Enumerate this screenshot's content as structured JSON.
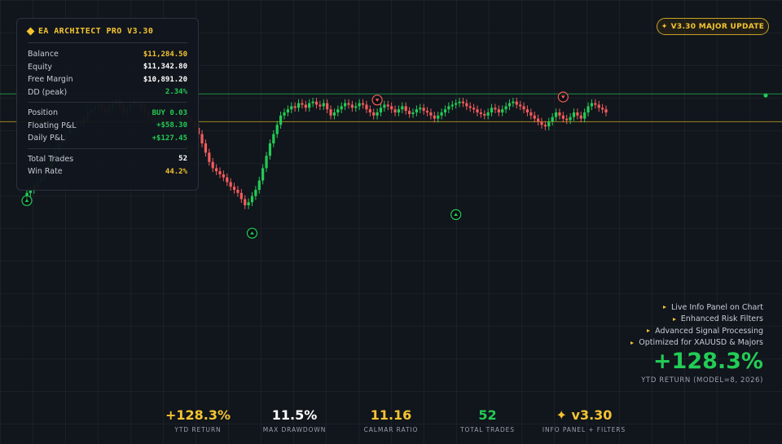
{
  "info_panel": {
    "title": "EA ARCHITECT PRO V3.30",
    "groups": [
      [
        {
          "label": "Balance",
          "value": "$11,284.50",
          "color": "#f4c430"
        },
        {
          "label": "Equity",
          "value": "$11,342.80",
          "color": "#ffffff"
        },
        {
          "label": "Free Margin",
          "value": "$10,891.20",
          "color": "#ffffff"
        },
        {
          "label": "DD (peak)",
          "value": "2.34%",
          "color": "#22cc55"
        }
      ],
      [
        {
          "label": "Position",
          "value": "BUY 0.03",
          "color": "#22cc55"
        },
        {
          "label": "Floating P&L",
          "value": "+$58.30",
          "color": "#22cc55"
        },
        {
          "label": "Daily P&L",
          "value": "+$127.45",
          "color": "#22cc55"
        }
      ],
      [
        {
          "label": "Total Trades",
          "value": "52",
          "color": "#ffffff"
        },
        {
          "label": "Win Rate",
          "value": "44.2%",
          "color": "#f4c430"
        }
      ]
    ]
  },
  "badge": {
    "icon": "sparkle-icon",
    "label": "V3.30 MAJOR UPDATE"
  },
  "features": [
    "Live Info Panel on Chart",
    "Enhanced Risk Filters",
    "Advanced Signal Processing",
    "Optimized for XAUUSD & Majors"
  ],
  "headline": {
    "value": "+128.3%",
    "caption": "YTD RETURN (MODEL=8, 2026)"
  },
  "stats": [
    {
      "value": "+128.3%",
      "label": "YTD RETURN",
      "color": "#f4c430"
    },
    {
      "value": "11.5%",
      "label": "MAX DRAWDOWN",
      "color": "#ffffff"
    },
    {
      "value": "11.16",
      "label": "CALMAR RATIO",
      "color": "#f4c430"
    },
    {
      "value": "52",
      "label": "TOTAL TRADES",
      "color": "#22cc55"
    },
    {
      "value": "✦ v3.30",
      "label": "INFO PANEL + FILTERS",
      "color": "#f4c430"
    }
  ],
  "colors": {
    "up": "#22cc55",
    "down": "#f25c5c",
    "resistance": "#1fa84a",
    "support": "#b89a1e",
    "accent": "#f4c430"
  },
  "chart_data": {
    "type": "candlestick",
    "closes": [
      0.28,
      0.3,
      0.32,
      0.35,
      0.38,
      0.42,
      0.45,
      0.5,
      0.55,
      0.6,
      0.62,
      0.66,
      0.7,
      0.72,
      0.74,
      0.73,
      0.76,
      0.8,
      0.82,
      0.84,
      0.85,
      0.82,
      0.8,
      0.83,
      0.86,
      0.88,
      0.84,
      0.8,
      0.82,
      0.85,
      0.87,
      0.86,
      0.83,
      0.8,
      0.78,
      0.75,
      0.76,
      0.77,
      0.74,
      0.72,
      0.7,
      0.72,
      0.74,
      0.77,
      0.78,
      0.76,
      0.74,
      0.7,
      0.66,
      0.6,
      0.54,
      0.48,
      0.44,
      0.42,
      0.4,
      0.38,
      0.35,
      0.32,
      0.3,
      0.28,
      0.24,
      0.2,
      0.22,
      0.26,
      0.3,
      0.36,
      0.44,
      0.52,
      0.6,
      0.66,
      0.72,
      0.78,
      0.8,
      0.82,
      0.84,
      0.83,
      0.86,
      0.85,
      0.83,
      0.86,
      0.87,
      0.85,
      0.84,
      0.86,
      0.82,
      0.78,
      0.8,
      0.82,
      0.84,
      0.86,
      0.85,
      0.83,
      0.84,
      0.86,
      0.85,
      0.82,
      0.8,
      0.78,
      0.8,
      0.83,
      0.85,
      0.84,
      0.82,
      0.8,
      0.82,
      0.84,
      0.81,
      0.79,
      0.8,
      0.82,
      0.83,
      0.81,
      0.8,
      0.78,
      0.76,
      0.78,
      0.8,
      0.82,
      0.84,
      0.85,
      0.86,
      0.87,
      0.86,
      0.84,
      0.83,
      0.82,
      0.8,
      0.79,
      0.78,
      0.8,
      0.83,
      0.82,
      0.8,
      0.82,
      0.84,
      0.86,
      0.87,
      0.85,
      0.84,
      0.82,
      0.8,
      0.78,
      0.76,
      0.74,
      0.72,
      0.71,
      0.74,
      0.77,
      0.8,
      0.78,
      0.76,
      0.75,
      0.77,
      0.8,
      0.78,
      0.76,
      0.8,
      0.84,
      0.86,
      0.85,
      0.83,
      0.82,
      0.8
    ],
    "signals": [
      {
        "dir": "buy",
        "index": 0,
        "offset": -0.05
      },
      {
        "dir": "buy",
        "index": 45,
        "offset": -0.21
      },
      {
        "dir": "buy",
        "index": 63,
        "offset": -0.24
      },
      {
        "dir": "sell",
        "index": 98,
        "offset": 0.08
      },
      {
        "dir": "buy",
        "index": 120,
        "offset": -0.72
      },
      {
        "dir": "sell",
        "index": 150,
        "offset": 0.14
      }
    ],
    "levels": {
      "resistance": 0.92,
      "support": 0.74
    }
  }
}
